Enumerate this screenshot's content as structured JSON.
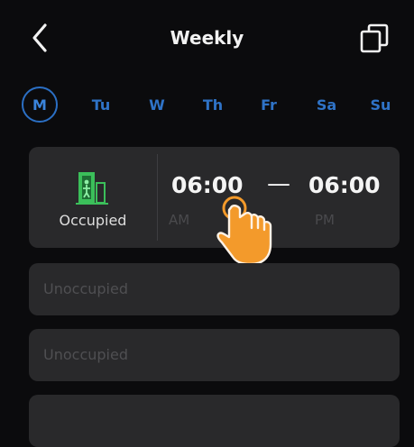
{
  "header": {
    "title": "Weekly",
    "back_icon": "chevron-left-icon",
    "copy_icon": "copy-icon"
  },
  "days": {
    "items": [
      {
        "label": "M",
        "selected": true
      },
      {
        "label": "Tu",
        "selected": false
      },
      {
        "label": "W",
        "selected": false
      },
      {
        "label": "Th",
        "selected": false
      },
      {
        "label": "Fr",
        "selected": false
      },
      {
        "label": "Sa",
        "selected": false
      },
      {
        "label": "Su",
        "selected": false
      }
    ]
  },
  "schedule": {
    "status_label": "Occupied",
    "status_icon": "occupied-door-icon",
    "start_time": "06:00",
    "start_period": "AM",
    "separator": "—",
    "end_time": "06:00",
    "end_period": "PM"
  },
  "slots": [
    {
      "label": "Unoccupied"
    },
    {
      "label": "Unoccupied"
    },
    {
      "label": ""
    }
  ],
  "colors": {
    "background": "#0b0b0d",
    "card": "#29292b",
    "accent_blue": "#2f73c7",
    "icon_green": "#3bbf5a",
    "hand_orange": "#f39a2b"
  }
}
